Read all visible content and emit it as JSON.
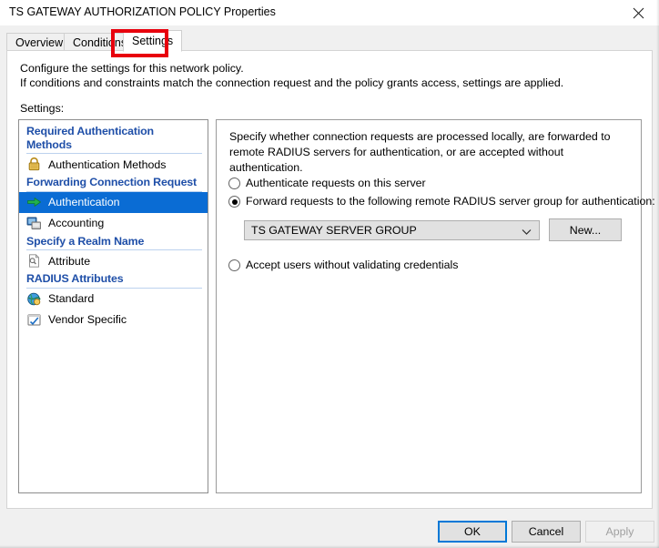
{
  "window": {
    "title": "TS GATEWAY AUTHORIZATION POLICY Properties",
    "close_icon": "close-icon"
  },
  "tabs": [
    {
      "label": "Overview",
      "active": false
    },
    {
      "label": "Conditions",
      "active": false
    },
    {
      "label": "Settings",
      "active": true
    }
  ],
  "page": {
    "intro_line1": "Configure the settings for this network policy.",
    "intro_line2": "If conditions and constraints match the connection request and the policy grants access, settings are applied.",
    "settings_label": "Settings:"
  },
  "tree": [
    {
      "type": "heading",
      "label": "Required Authentication Methods"
    },
    {
      "type": "item",
      "label": "Authentication Methods",
      "icon": "padlock-icon",
      "selected": false
    },
    {
      "type": "heading",
      "label": "Forwarding Connection Request"
    },
    {
      "type": "item",
      "label": "Authentication",
      "icon": "green-arrow-icon",
      "selected": true
    },
    {
      "type": "item",
      "label": "Accounting",
      "icon": "monitor-icon",
      "selected": false
    },
    {
      "type": "heading",
      "label": "Specify a Realm Name"
    },
    {
      "type": "item",
      "label": "Attribute",
      "icon": "document-search-icon",
      "selected": false
    },
    {
      "type": "heading",
      "label": "RADIUS Attributes"
    },
    {
      "type": "item",
      "label": "Standard",
      "icon": "globe-icon",
      "selected": false
    },
    {
      "type": "item",
      "label": "Vendor Specific",
      "icon": "checkbox-blue-icon",
      "selected": false
    }
  ],
  "content": {
    "description": "Specify whether connection requests are processed locally, are forwarded to remote RADIUS servers for authentication, or are accepted without authentication.",
    "radio_local": "Authenticate requests on this server",
    "radio_forward": "Forward requests to the following remote RADIUS server group for authentication:",
    "radio_accept": "Accept users without validating credentials",
    "selected_radio": "radio_forward",
    "server_group_value": "TS GATEWAY SERVER GROUP",
    "new_button": "New..."
  },
  "footer": {
    "ok": "OK",
    "cancel": "Cancel",
    "apply": "Apply",
    "apply_disabled": true
  },
  "annotation": {
    "color": "#e8000d",
    "target": "Settings"
  },
  "colors": {
    "heading_blue": "#1f4fa8",
    "selection_blue": "#0a6cd4",
    "focus_blue": "#0078d7",
    "dialog_gray": "#f0f0f0",
    "button_gray": "#e1e1e1"
  }
}
